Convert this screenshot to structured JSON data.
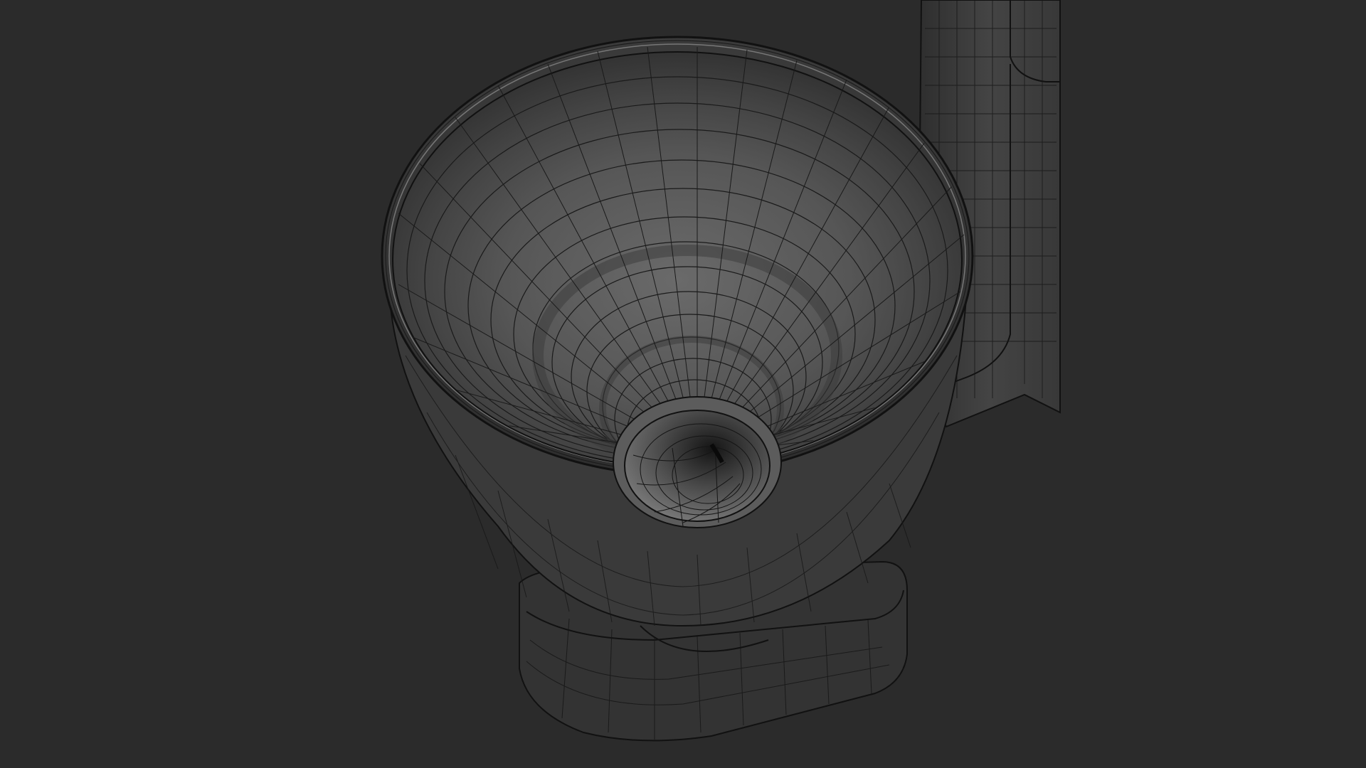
{
  "scene": {
    "background_color": "#2b2b2b",
    "wire_color": "#0f0f0f",
    "surface_dark": "#3a3a3a",
    "surface_mid": "#5a5a5a",
    "surface_light": "#7a7a7a",
    "objects": [
      "hopper-bowl",
      "funnel-throat",
      "base-plate",
      "support-column"
    ]
  }
}
